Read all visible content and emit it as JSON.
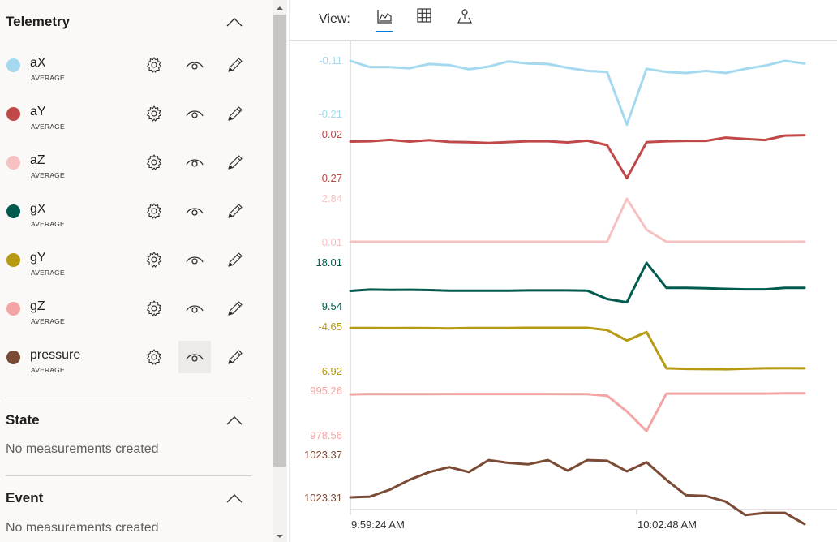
{
  "telemetry": {
    "title": "Telemetry",
    "items": [
      {
        "name": "aX",
        "agg": "AVERAGE",
        "color": "#a4d9ef"
      },
      {
        "name": "aY",
        "agg": "AVERAGE",
        "color": "#c04848"
      },
      {
        "name": "aZ",
        "agg": "AVERAGE",
        "color": "#f7c1c1"
      },
      {
        "name": "gX",
        "agg": "AVERAGE",
        "color": "#005a4e"
      },
      {
        "name": "gY",
        "agg": "AVERAGE",
        "color": "#b59a12"
      },
      {
        "name": "gZ",
        "agg": "AVERAGE",
        "color": "#f4a4a4"
      },
      {
        "name": "pressure",
        "agg": "AVERAGE",
        "color": "#7b4a35"
      }
    ]
  },
  "state": {
    "title": "State",
    "empty": "No measurements created"
  },
  "event": {
    "title": "Event",
    "empty": "No measurements created"
  },
  "view": {
    "label": "View:",
    "active": "line-chart-icon"
  },
  "chart_data": {
    "type": "line",
    "x_ticks": [
      "9:59:24 AM",
      "10:02:48 AM"
    ],
    "points_per_series": 24,
    "series": [
      {
        "name": "aX",
        "color": "#a4d9ef",
        "y_top_label": "-0.11",
        "y_bottom_label": "-0.21",
        "ylim": [
          -0.21,
          -0.11
        ],
        "values": [
          -0.11,
          -0.122,
          -0.122,
          -0.124,
          -0.116,
          -0.118,
          -0.126,
          -0.121,
          -0.111,
          -0.115,
          -0.116,
          -0.123,
          -0.129,
          -0.131,
          -0.231,
          -0.125,
          -0.131,
          -0.133,
          -0.129,
          -0.133,
          -0.125,
          -0.119,
          -0.11,
          -0.115
        ]
      },
      {
        "name": "aY",
        "color": "#c04848",
        "y_top_label": "-0.02",
        "y_bottom_label": "-0.27",
        "ylim": [
          -0.27,
          -0.02
        ],
        "values": [
          -0.06,
          -0.058,
          -0.05,
          -0.06,
          -0.052,
          -0.062,
          -0.064,
          -0.068,
          -0.063,
          -0.058,
          -0.058,
          -0.065,
          -0.055,
          -0.081,
          -0.273,
          -0.064,
          -0.058,
          -0.056,
          -0.056,
          -0.037,
          -0.045,
          -0.051,
          -0.025,
          -0.023
        ]
      },
      {
        "name": "aZ",
        "color": "#f7c1c1",
        "y_top_label": "2.84",
        "y_bottom_label": "-0.01",
        "ylim": [
          -0.01,
          2.84
        ],
        "values": [
          -0.01,
          -0.01,
          -0.01,
          -0.01,
          -0.01,
          -0.01,
          -0.01,
          -0.01,
          -0.01,
          -0.01,
          -0.01,
          -0.01,
          -0.01,
          -0.01,
          2.84,
          0.79,
          -0.01,
          -0.01,
          -0.01,
          -0.01,
          -0.01,
          -0.01,
          -0.008,
          -0.004
        ]
      },
      {
        "name": "gX",
        "color": "#005a4e",
        "y_top_label": "18.01",
        "y_bottom_label": "9.54",
        "ylim": [
          9.54,
          18.01
        ],
        "values": [
          12.5,
          12.75,
          12.7,
          12.72,
          12.65,
          12.55,
          12.55,
          12.55,
          12.55,
          12.6,
          12.6,
          12.6,
          12.55,
          10.9,
          10.25,
          18.01,
          13.1,
          13.1,
          13.0,
          12.9,
          12.8,
          12.8,
          13.1,
          13.1
        ]
      },
      {
        "name": "gY",
        "color": "#b59a12",
        "y_top_label": "-4.65",
        "y_bottom_label": "-6.92",
        "ylim": [
          -6.92,
          -4.65
        ],
        "values": [
          -4.7,
          -4.7,
          -4.71,
          -4.7,
          -4.71,
          -4.72,
          -4.7,
          -4.7,
          -4.7,
          -4.69,
          -4.69,
          -4.69,
          -4.69,
          -4.81,
          -5.35,
          -4.91,
          -6.79,
          -6.82,
          -6.83,
          -6.84,
          -6.81,
          -6.79,
          -6.78,
          -6.79
        ]
      },
      {
        "name": "gZ",
        "color": "#f4a4a4",
        "y_top_label": "995.26",
        "y_bottom_label": "978.56",
        "ylim": [
          978.56,
          995.26
        ],
        "values": [
          994.0,
          994.15,
          994.1,
          994.1,
          994.1,
          994.15,
          994.15,
          994.15,
          994.15,
          994.15,
          994.15,
          994.1,
          994.1,
          993.5,
          987.5,
          980.0,
          994.3,
          994.3,
          994.3,
          994.3,
          994.3,
          994.3,
          994.4,
          994.4
        ]
      },
      {
        "name": "pressure",
        "color": "#7b4a35",
        "y_top_label": "1023.37",
        "y_bottom_label": "1023.31",
        "ylim": [
          1023.31,
          1023.37
        ],
        "values": [
          1023.31,
          1023.311,
          1023.321,
          1023.335,
          1023.346,
          1023.353,
          1023.346,
          1023.363,
          1023.359,
          1023.357,
          1023.363,
          1023.348,
          1023.363,
          1023.362,
          1023.347,
          1023.36,
          1023.335,
          1023.313,
          1023.312,
          1023.304,
          1023.285,
          1023.288,
          1023.288,
          1023.272
        ]
      }
    ]
  }
}
